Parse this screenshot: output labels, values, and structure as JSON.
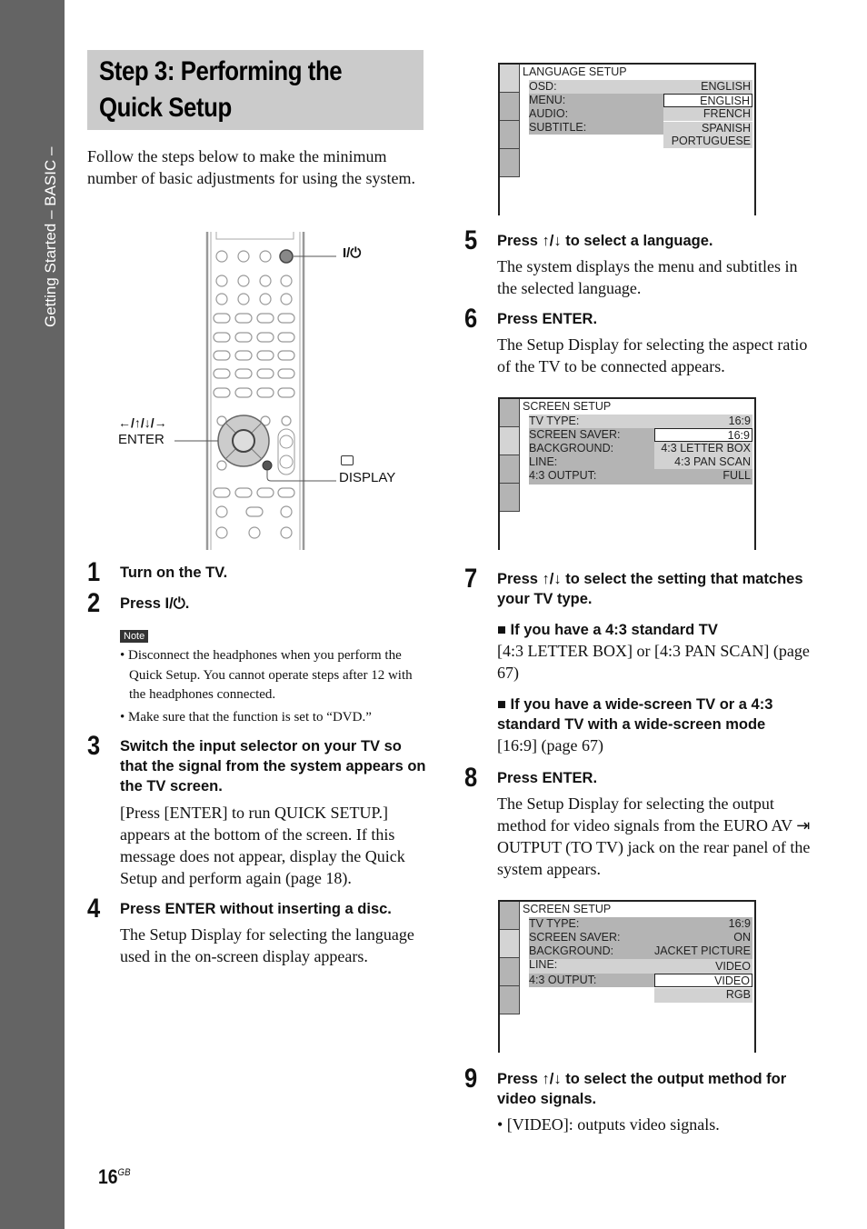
{
  "sidebar": {
    "section_label": "Getting Started – BASIC –"
  },
  "header": {
    "title_line1": "Step 3: Performing the",
    "title_line2": "Quick Setup"
  },
  "intro": "Follow the steps below to make the minimum number of basic adjustments for using the system.",
  "remote": {
    "power_label": "I/⏻",
    "arrows_label": "←/↑/↓/→",
    "enter_label": "ENTER",
    "display_label": "DISPLAY",
    "display_icon": "display-icon"
  },
  "steps": [
    {
      "num": "1",
      "heading": "Turn on the TV."
    },
    {
      "num": "2",
      "heading": "Press I/⏻."
    },
    {
      "num": "3",
      "heading": "Switch the input selector on your TV so that the signal from the system appears on the TV screen.",
      "body": "[Press [ENTER] to run QUICK SETUP.] appears at the bottom of the screen. If this message does not appear, display the Quick Setup and perform again (page 18)."
    },
    {
      "num": "4",
      "heading": "Press ENTER without inserting a disc.",
      "body": "The Setup Display for selecting the language used in the on-screen display appears."
    },
    {
      "num": "5",
      "heading": "Press ↑/↓ to select a language.",
      "body": "The system displays the menu and subtitles in the selected language."
    },
    {
      "num": "6",
      "heading": "Press ENTER.",
      "body": "The Setup Display for selecting the aspect ratio of the TV to be connected appears."
    },
    {
      "num": "7",
      "heading": "Press ↑/↓ to select the setting that matches your TV type.",
      "cases": [
        {
          "head": "■ If you have a 4:3 standard TV",
          "body": "[4:3 LETTER BOX] or [4:3 PAN SCAN] (page 67)"
        },
        {
          "head": "■ If you have a wide-screen TV or a 4:3 standard TV with a wide-screen mode",
          "body": "[16:9] (page 67)"
        }
      ]
    },
    {
      "num": "8",
      "heading": "Press ENTER.",
      "body": "The Setup Display for selecting the output method for video signals from the EURO AV ⇥ OUTPUT (TO TV) jack on the rear panel of the system appears."
    },
    {
      "num": "9",
      "heading": "Press ↑/↓ to select the output method for video signals.",
      "body": "• [VIDEO]: outputs video signals."
    }
  ],
  "note": {
    "label": "Note",
    "items": [
      "• Disconnect the headphones when you perform the Quick Setup. You cannot operate steps after 12 with the headphones connected.",
      "• Make sure that the function is set to “DVD.”"
    ]
  },
  "osd_language": {
    "title": "LANGUAGE SETUP",
    "rows": [
      "OSD:",
      "MENU:",
      "AUDIO:",
      "SUBTITLE:"
    ],
    "osd_value": "ENGLISH",
    "options": [
      "ENGLISH",
      "FRENCH",
      "SPANISH",
      "PORTUGUESE"
    ],
    "selected": "ENGLISH"
  },
  "osd_screen1": {
    "title": "SCREEN SETUP",
    "rows": [
      "TV TYPE:",
      "SCREEN SAVER:",
      "BACKGROUND:",
      "LINE:",
      "4:3 OUTPUT:"
    ],
    "tv_type_value": "16:9",
    "options": [
      "16:9",
      "4:3 LETTER BOX",
      "4:3 PAN SCAN"
    ],
    "selected": "16:9",
    "output_value": "FULL"
  },
  "osd_screen2": {
    "title": "SCREEN SETUP",
    "rows": [
      "TV TYPE:",
      "SCREEN SAVER:",
      "BACKGROUND:",
      "LINE:",
      "4:3 OUTPUT:"
    ],
    "values": [
      "16:9",
      "ON",
      "JACKET PICTURE",
      "VIDEO"
    ],
    "options": [
      "VIDEO",
      "RGB"
    ],
    "selected": "VIDEO"
  },
  "footer": {
    "page": "16",
    "suffix": "GB"
  }
}
